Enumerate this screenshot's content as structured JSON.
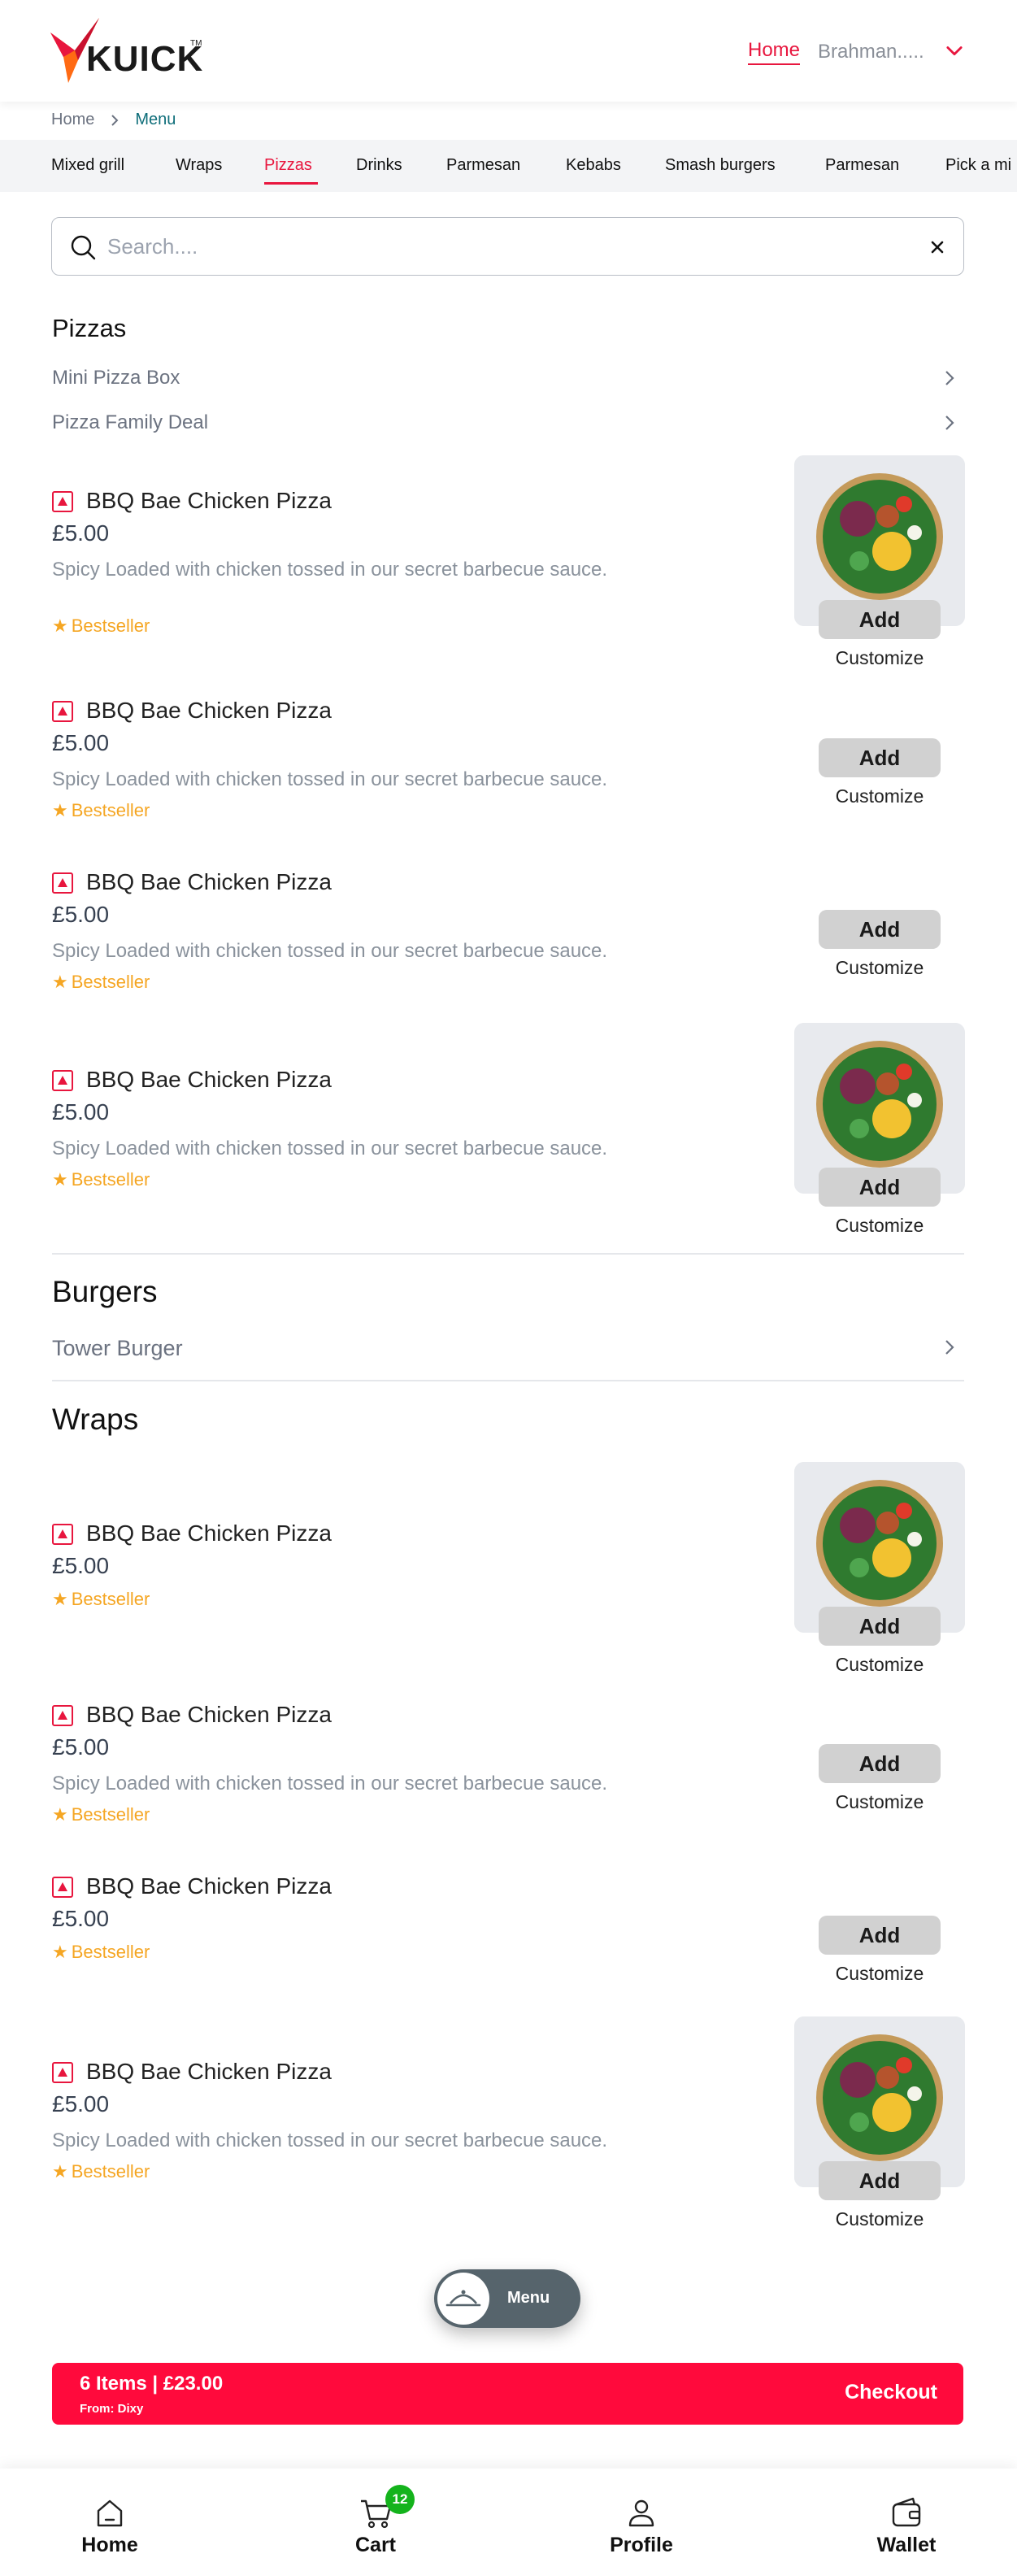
{
  "header": {
    "brand": "KUICK",
    "nav_home": "Home",
    "user": "Brahman....."
  },
  "breadcrumb": {
    "home": "Home",
    "current": "Menu"
  },
  "categories": [
    "Mixed grill",
    "Wraps",
    "Pizzas",
    "Drinks",
    "Parmesan",
    "Kebabs",
    "Smash burgers",
    "Parmesan",
    "Pick a mi"
  ],
  "active_category": "Pizzas",
  "search": {
    "placeholder": "Search...."
  },
  "pizzas": {
    "title": "Pizzas",
    "subs": [
      "Mini Pizza Box",
      "Pizza Family Deal"
    ],
    "items": [
      {
        "name": "BBQ Bae Chicken Pizza",
        "price": "£5.00",
        "desc": "Spicy Loaded with chicken tossed in our secret barbecue sauce.",
        "badge": "Bestseller",
        "add": "Add",
        "customize": "Customize"
      },
      {
        "name": "BBQ Bae Chicken Pizza",
        "price": "£5.00",
        "desc": "Spicy Loaded with chicken tossed in our secret barbecue sauce.",
        "badge": "Bestseller",
        "add": "Add",
        "customize": "Customize"
      },
      {
        "name": "BBQ Bae Chicken Pizza",
        "price": "£5.00",
        "desc": "Spicy Loaded with chicken tossed in our secret barbecue sauce.",
        "badge": "Bestseller",
        "add": "Add",
        "customize": "Customize"
      },
      {
        "name": "BBQ Bae Chicken Pizza",
        "price": "£5.00",
        "desc": "Spicy Loaded with chicken tossed in our secret barbecue sauce.",
        "badge": "Bestseller",
        "add": "Add",
        "customize": "Customize"
      }
    ]
  },
  "burgers": {
    "title": "Burgers",
    "subs": [
      "Tower Burger"
    ]
  },
  "wraps": {
    "title": "Wraps",
    "items": [
      {
        "name": "BBQ Bae Chicken Pizza",
        "price": "£5.00",
        "badge": "Bestseller",
        "add": "Add",
        "customize": "Customize"
      },
      {
        "name": "BBQ Bae Chicken Pizza",
        "price": "£5.00",
        "desc": "Spicy Loaded with chicken tossed in our secret barbecue sauce.",
        "badge": "Bestseller",
        "add": "Add",
        "customize": "Customize"
      },
      {
        "name": "BBQ Bae Chicken Pizza",
        "price": "£5.00",
        "badge": "Bestseller",
        "add": "Add",
        "customize": "Customize"
      },
      {
        "name": "BBQ Bae Chicken Pizza",
        "price": "£5.00",
        "desc": "Spicy Loaded with chicken tossed in our secret barbecue sauce.",
        "badge": "Bestseller",
        "add": "Add",
        "customize": "Customize"
      }
    ]
  },
  "float_menu": {
    "label": "Menu"
  },
  "checkout": {
    "items_text": "6 Items  |  £23.00",
    "from": "From: Dixy",
    "button": "Checkout"
  },
  "bottom_nav": {
    "home": "Home",
    "cart": "Cart",
    "cart_count": "12",
    "profile": "Profile",
    "wallet": "Wallet"
  },
  "colors": {
    "accent": "#e8163e",
    "checkout": "#ff0a3c",
    "bestseller": "#f5a623",
    "badge": "#14b31c"
  }
}
